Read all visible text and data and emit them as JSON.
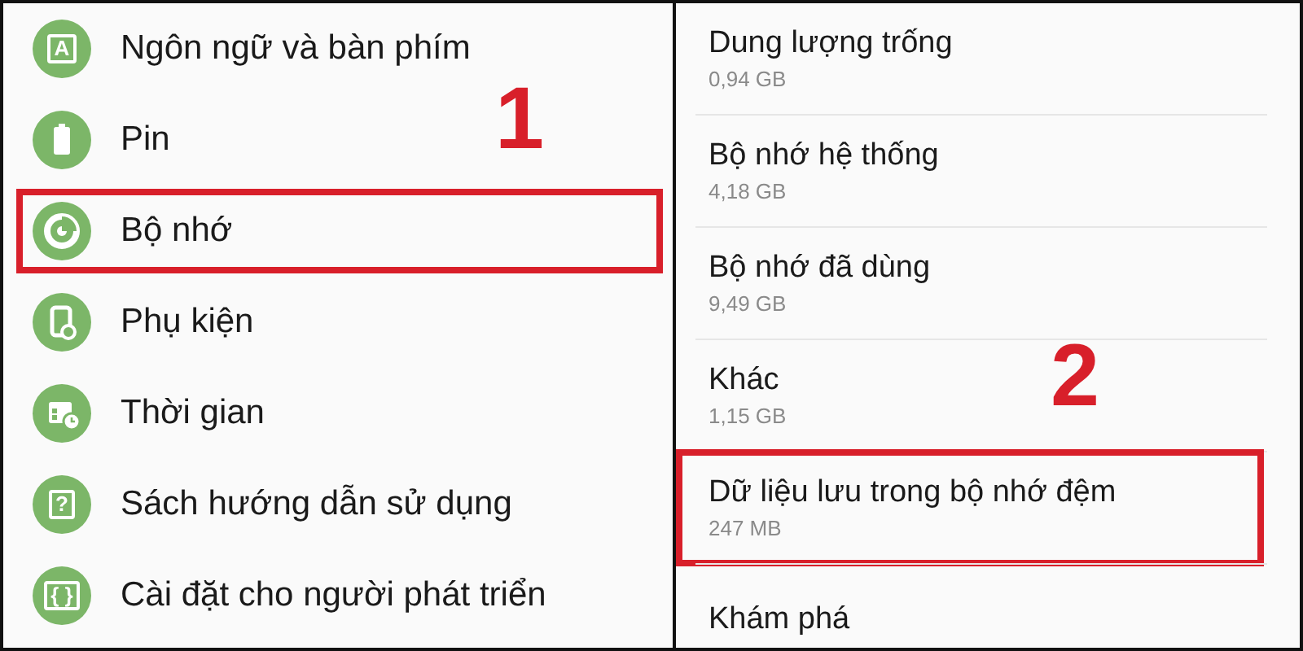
{
  "settings": {
    "callout": "1",
    "items": [
      {
        "label": "Ngôn ngữ và bàn phím",
        "kind": "letter",
        "glyph": "A",
        "highlighted": false
      },
      {
        "label": "Pin",
        "kind": "battery",
        "highlighted": false
      },
      {
        "label": "Bộ nhớ",
        "kind": "storage",
        "highlighted": true
      },
      {
        "label": "Phụ kiện",
        "kind": "accessory",
        "highlighted": false
      },
      {
        "label": "Thời gian",
        "kind": "calendar",
        "highlighted": false
      },
      {
        "label": "Sách hướng dẫn sử dụng",
        "kind": "letter",
        "glyph": "?",
        "highlighted": false
      },
      {
        "label": "Cài đặt cho người phát triển",
        "kind": "letter",
        "glyph": "{ }",
        "highlighted": false
      }
    ]
  },
  "storage": {
    "callout": "2",
    "items": [
      {
        "title": "Dung lượng trống",
        "value": "0,94 GB",
        "highlighted": false
      },
      {
        "title": "Bộ nhớ hệ thống",
        "value": "4,18 GB",
        "highlighted": false
      },
      {
        "title": "Bộ nhớ đã dùng",
        "value": "9,49 GB",
        "highlighted": false
      },
      {
        "title": "Khác",
        "value": "1,15 GB",
        "highlighted": false
      },
      {
        "title": "Dữ liệu lưu trong bộ nhớ đệm",
        "value": "247 MB",
        "highlighted": true
      },
      {
        "title": "Khám phá",
        "highlighted": false
      }
    ]
  }
}
